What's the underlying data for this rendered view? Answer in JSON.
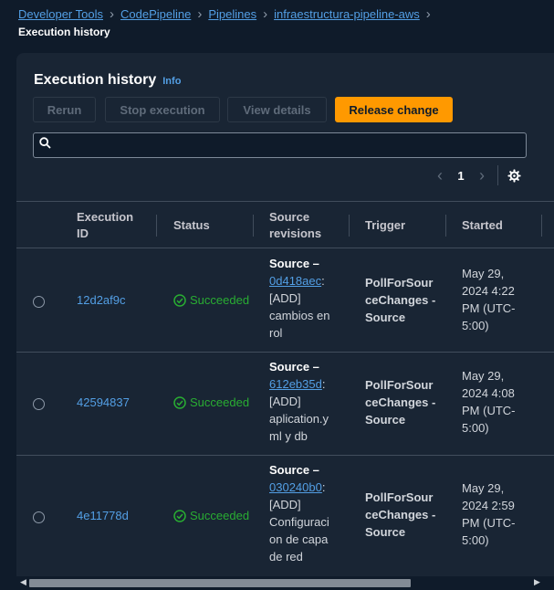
{
  "breadcrumb": {
    "items": [
      "Developer Tools",
      "CodePipeline",
      "Pipelines",
      "infraestructura-pipeline-aws"
    ],
    "current": "Execution history"
  },
  "panel": {
    "title": "Execution history",
    "info": "Info"
  },
  "toolbar": {
    "rerun": "Rerun",
    "stop": "Stop execution",
    "view": "View details",
    "release": "Release change"
  },
  "search": {
    "placeholder": "",
    "value": ""
  },
  "pagination": {
    "page": "1"
  },
  "table": {
    "headers": {
      "execution_id": [
        "Execution",
        "ID"
      ],
      "status": "Status",
      "source_revisions": [
        "Source",
        "revisions"
      ],
      "trigger": "Trigger",
      "started": "Started"
    },
    "rows": [
      {
        "execution_id": "12d2af9c",
        "status": "Succeeded",
        "source_title": "Source –",
        "commit": "0d418aec",
        "message": [
          "[ADD]",
          "cambios en",
          "rol"
        ],
        "trigger": [
          "PollForSour",
          "ceChanges -",
          "Source"
        ],
        "started": [
          "May 29,",
          "2024 4:22",
          "PM (UTC-",
          "5:00)"
        ]
      },
      {
        "execution_id": "42594837",
        "status": "Succeeded",
        "source_title": "Source –",
        "commit": "612eb35d",
        "message": [
          "[ADD]",
          "aplication.y",
          "ml y db"
        ],
        "trigger": [
          "PollForSour",
          "ceChanges -",
          "Source"
        ],
        "started": [
          "May 29,",
          "2024 4:08",
          "PM (UTC-",
          "5:00)"
        ]
      },
      {
        "execution_id": "4e11778d",
        "status": "Succeeded",
        "source_title": "Source –",
        "commit": "030240b0",
        "message": [
          "[ADD]",
          "Configuraci",
          "on de capa",
          "de red"
        ],
        "trigger": [
          "PollForSour",
          "ceChanges -",
          "Source"
        ],
        "started": [
          "May 29,",
          "2024 2:59",
          "PM (UTC-",
          "5:00)"
        ]
      }
    ]
  },
  "colors": {
    "background": "#0f1b2a",
    "panel": "#192534",
    "accent": "#ff9900",
    "link": "#539fe5",
    "success": "#29ad32"
  },
  "icons": {
    "search": "search-icon",
    "prev": "chevron-left-icon",
    "next": "chevron-right-icon",
    "settings": "gear-icon",
    "status": "check-circle-icon"
  }
}
